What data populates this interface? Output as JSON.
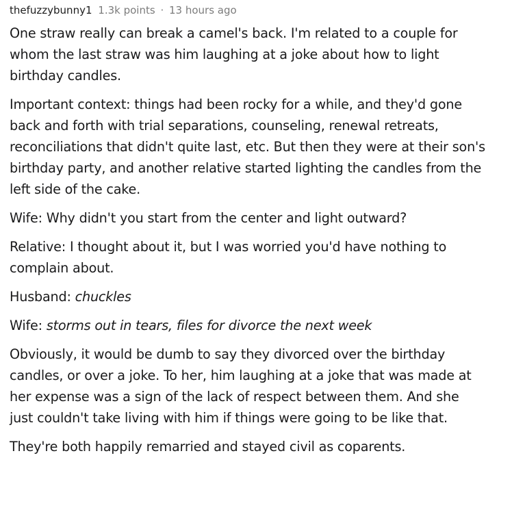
{
  "comment": {
    "author": "thefuzzybunny1",
    "points": "1.3k points",
    "separator": "·",
    "time": "13 hours ago",
    "p1": [
      "One straw really can break a camel's back. I'm related to a couple for",
      "whom the last straw was him laughing at a joke about how to light",
      "birthday candles."
    ],
    "p2": [
      "Important context: things had been rocky for a while, and they'd gone",
      "back and forth with trial separations, counseling, renewal retreats,",
      "reconciliations that didn't quite last, etc. But then they were at their son's",
      "birthday party, and another relative started lighting the candles from the",
      "left side of the cake."
    ],
    "p3": [
      "Wife: Why didn't you start from the center and light outward?"
    ],
    "p4": [
      "Relative: I thought about it, but I was worried you'd have nothing to",
      "complain about."
    ],
    "p5": {
      "speaker": "Husband: ",
      "action": "chuckles"
    },
    "p6": {
      "speaker": "Wife: ",
      "action": "storms out in tears, files for divorce the next week"
    },
    "p7": [
      "Obviously, it would be dumb to say they divorced over the birthday",
      "candles, or over a joke. To her, him laughing at a joke that was made at",
      "her expense was a sign of the lack of respect between them. And she",
      "just couldn't take living with him if things were going to be like that."
    ],
    "p8": [
      "They're both happily remarried and stayed civil as coparents."
    ]
  }
}
